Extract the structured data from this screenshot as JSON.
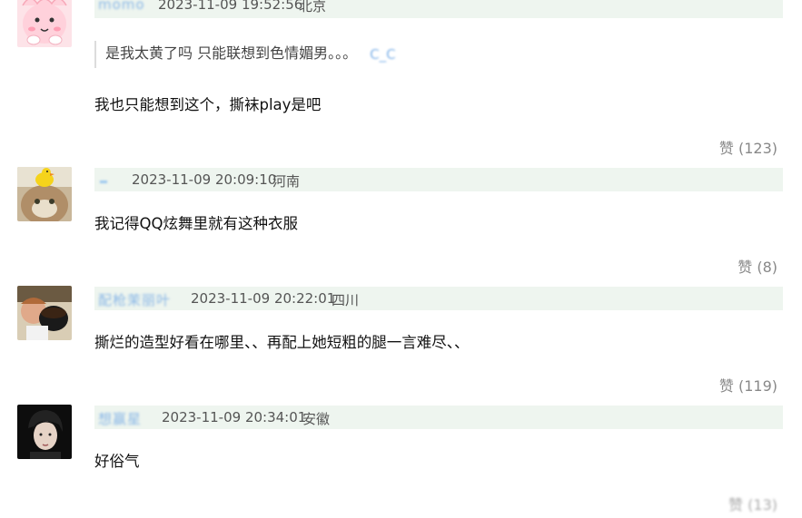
{
  "comments": [
    {
      "username": "momo",
      "timestamp": "2023-11-09 19:52:56",
      "location": "北京",
      "quote": "是我太黄了吗 只能联想到色情媚男。。。",
      "quote_emoticon": "C_C",
      "text": "我也只能想到这个，撕袜play是吧",
      "like_label": "赞",
      "like_count": "(123)"
    },
    {
      "username": "",
      "timestamp": "2023-11-09 20:09:10",
      "location": "河南",
      "text": "我记得QQ炫舞里就有这种衣服",
      "like_label": "赞",
      "like_count": "(8)"
    },
    {
      "username": "配枪茉丽叶",
      "timestamp": "2023-11-09 20:22:01",
      "location": "四川",
      "text": "撕烂的造型好看在哪里、、再配上她短粗的腿一言难尽、、",
      "like_label": "赞",
      "like_count": "(119)"
    },
    {
      "username": "想赢星",
      "timestamp": "2023-11-09 20:34:01",
      "location": "安徽",
      "text": "好俗气",
      "like_label": "赞",
      "like_count": "(13)"
    }
  ],
  "colors": {
    "meta_bar_bg": "#eef5ef",
    "username_blue": "#8ab7e6",
    "like_gray": "#888888"
  },
  "avatars": [
    "pink-cartoon-avatar",
    "cat-with-duck-avatar",
    "person-with-coffee-avatar",
    "dark-portrait-avatar"
  ]
}
